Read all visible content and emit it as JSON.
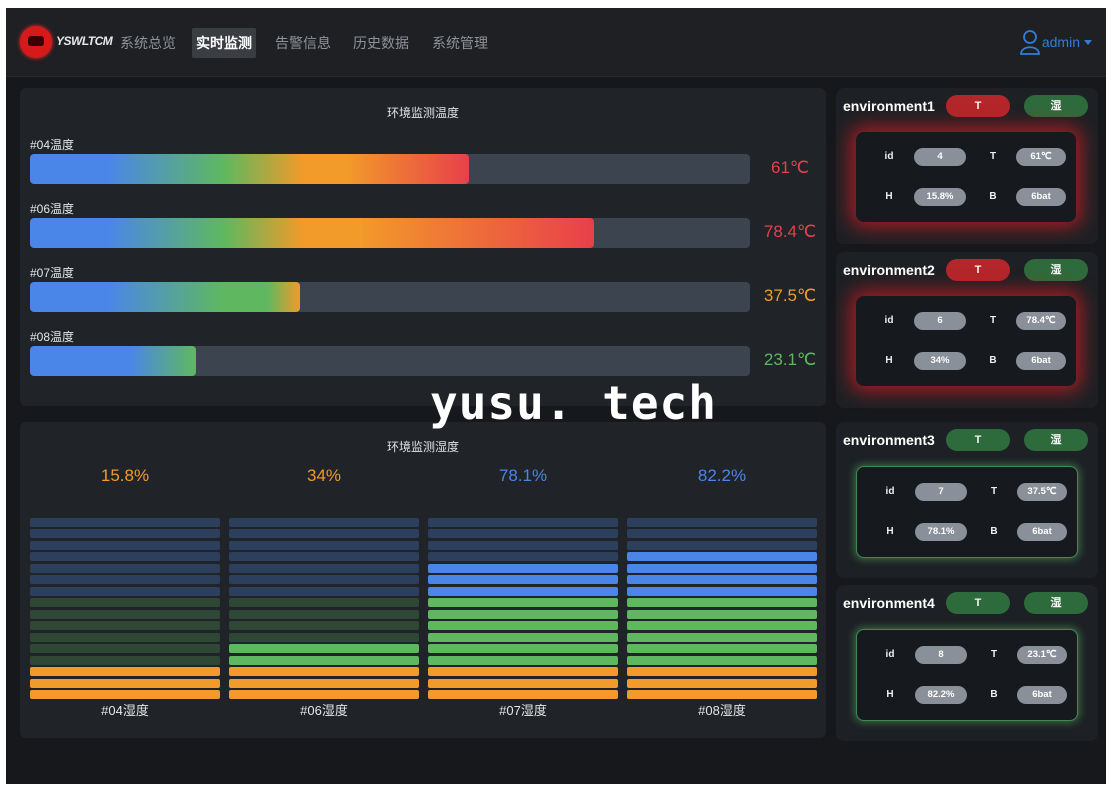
{
  "brand": "YSWLTCM",
  "nav": {
    "items": [
      "系统总览",
      "实时监测",
      "告警信息",
      "历史数据",
      "系统管理"
    ],
    "active_index": 1
  },
  "user": {
    "name": "admin"
  },
  "temperature_panel": {
    "title": "环境监测温度",
    "bars": [
      {
        "label": "#04温度",
        "value_text": "61℃",
        "value": 61,
        "color": "#e8404a"
      },
      {
        "label": "#06温度",
        "value_text": "78.4℃",
        "value": 78.4,
        "color": "#e8404a"
      },
      {
        "label": "#07温度",
        "value_text": "37.5℃",
        "value": 37.5,
        "color": "#f29a2a"
      },
      {
        "label": "#08温度",
        "value_text": "23.1℃",
        "value": 23.1,
        "color": "#5fb85f"
      }
    ]
  },
  "humidity_panel": {
    "title": "环境监测湿度",
    "columns": [
      {
        "label": "#04湿度",
        "value_text": "15.8%",
        "value": 15.8,
        "color": "#f29a2a"
      },
      {
        "label": "#06湿度",
        "value_text": "34%",
        "value": 34,
        "color": "#f29a2a"
      },
      {
        "label": "#07湿度",
        "value_text": "78.1%",
        "value": 78.1,
        "color": "#4a86e8"
      },
      {
        "label": "#08湿度",
        "value_text": "82.2%",
        "value": 82.2,
        "color": "#4a86e8"
      }
    ]
  },
  "environments": [
    {
      "name": "environment1",
      "status": "alarm",
      "t_button": "T",
      "h_button": "湿",
      "fields": {
        "id": "4",
        "T": "61℃",
        "H": "15.8%",
        "B": "6bat"
      }
    },
    {
      "name": "environment2",
      "status": "alarm",
      "t_button": "T",
      "h_button": "湿",
      "fields": {
        "id": "6",
        "T": "78.4℃",
        "H": "34%",
        "B": "6bat"
      }
    },
    {
      "name": "environment3",
      "status": "normal",
      "t_button": "T",
      "h_button": "湿",
      "fields": {
        "id": "7",
        "T": "37.5℃",
        "H": "78.1%",
        "B": "6bat"
      }
    },
    {
      "name": "environment4",
      "status": "normal",
      "t_button": "T",
      "h_button": "湿",
      "fields": {
        "id": "8",
        "T": "23.1℃",
        "H": "82.2%",
        "B": "6bat"
      }
    }
  ],
  "field_keys": {
    "id": "id",
    "T": "T",
    "H": "H",
    "B": "B"
  },
  "colors": {
    "alarm": "#b3262a",
    "normal": "#2e6b3c",
    "blue": "#4a86e8",
    "green": "#5fb85f",
    "orange": "#f29a2a",
    "red": "#e8404a"
  },
  "watermark": "yusu. tech"
}
